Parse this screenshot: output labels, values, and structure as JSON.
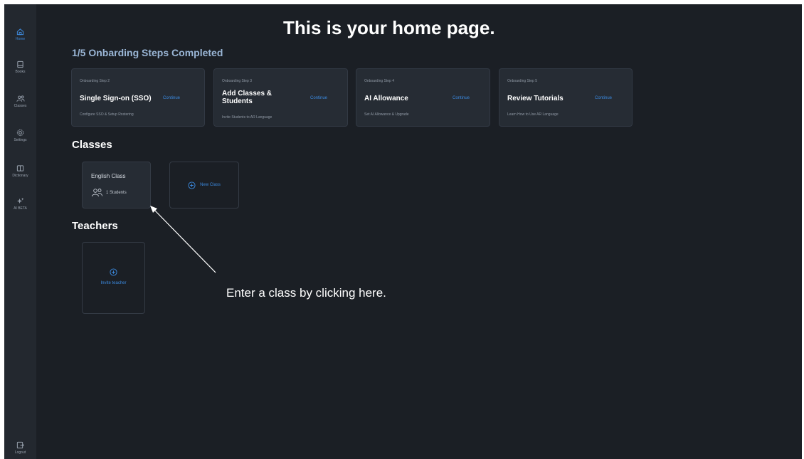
{
  "sidebar": {
    "items": [
      {
        "label": "Home",
        "icon": "home-icon",
        "active": true
      },
      {
        "label": "Books",
        "icon": "book-icon",
        "active": false
      },
      {
        "label": "Classes",
        "icon": "users-icon",
        "active": false
      },
      {
        "label": "Settings",
        "icon": "gear-icon",
        "active": false
      },
      {
        "label": "Dictionary",
        "icon": "dictionary-icon",
        "active": false
      },
      {
        "label": "AI BETA",
        "icon": "sparkle-icon",
        "active": false
      }
    ],
    "logout": {
      "label": "Logout",
      "icon": "logout-icon"
    }
  },
  "header": {
    "title": "This is your home page."
  },
  "onboarding": {
    "title": "1/5 Onbarding Steps Completed",
    "steps": [
      {
        "kicker": "Onboarding Step 2",
        "name": "Single Sign-on (SSO)",
        "action": "Continue",
        "desc": "Configure SSO & Setup Rostering"
      },
      {
        "kicker": "Onboarding Step 3",
        "name": "Add Classes & Students",
        "action": "Continue",
        "desc": "Invite Students to AR Language"
      },
      {
        "kicker": "Onboarding Step 4",
        "name": "AI Allowance",
        "action": "Continue",
        "desc": "Set AI Allowance & Upgrade"
      },
      {
        "kicker": "Onboarding Step 5",
        "name": "Review Tutorials",
        "action": "Continue",
        "desc": "Learn How to Use AR Language"
      }
    ]
  },
  "classes": {
    "title": "Classes",
    "items": [
      {
        "name": "English Class",
        "students": "1 Students"
      }
    ],
    "new_label": "New Class"
  },
  "teachers": {
    "title": "Teachers",
    "invite_label": "Invite teacher"
  },
  "annotation": {
    "text": "Enter a class by clicking here."
  },
  "colors": {
    "accent": "#3b8ae0",
    "background": "#1b1f25",
    "sidebar": "#23282f",
    "card": "#262c34"
  }
}
